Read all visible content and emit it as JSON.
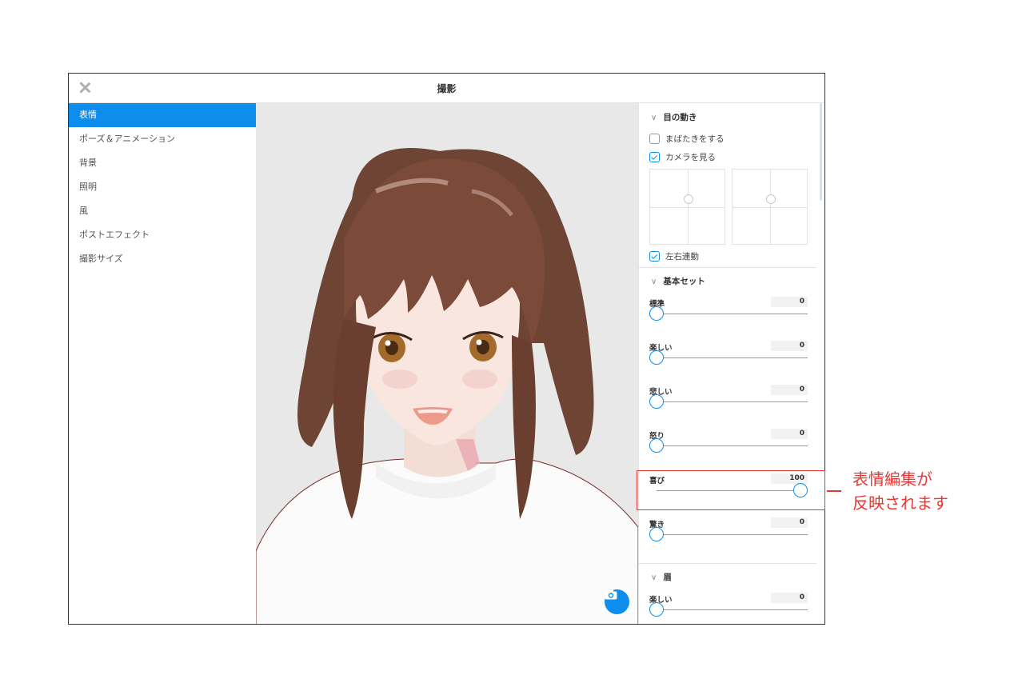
{
  "window": {
    "title": "撮影"
  },
  "sidebar": {
    "items": [
      {
        "label": "表情"
      },
      {
        "label": "ポーズ＆アニメーション"
      },
      {
        "label": "背景"
      },
      {
        "label": "照明"
      },
      {
        "label": "風"
      },
      {
        "label": "ポストエフェクト"
      },
      {
        "label": "撮影サイズ"
      }
    ]
  },
  "panel": {
    "eye": {
      "title": "目の動き",
      "blink": {
        "label": "まばたきをする",
        "checked": false
      },
      "look_camera": {
        "label": "カメラを見る",
        "checked": true
      },
      "sync": {
        "label": "左右連動",
        "checked": true
      }
    },
    "basic": {
      "title": "基本セット",
      "sliders": [
        {
          "label": "標準",
          "value": "0",
          "level": 0
        },
        {
          "label": "楽しい",
          "value": "0",
          "level": 0
        },
        {
          "label": "悲しい",
          "value": "0",
          "level": 0
        },
        {
          "label": "怒り",
          "value": "0",
          "level": 0
        },
        {
          "label": "喜び",
          "value": "100",
          "level": 100
        },
        {
          "label": "驚き",
          "value": "0",
          "level": 0
        }
      ]
    },
    "brow": {
      "title": "眉",
      "sliders": [
        {
          "label": "楽しい",
          "value": "0",
          "level": 0
        }
      ]
    }
  },
  "annotation": {
    "line1": "表情編集が",
    "line2": "反映されます"
  },
  "colors": {
    "accent": "#0d8eec",
    "annotation": "#e53935"
  }
}
